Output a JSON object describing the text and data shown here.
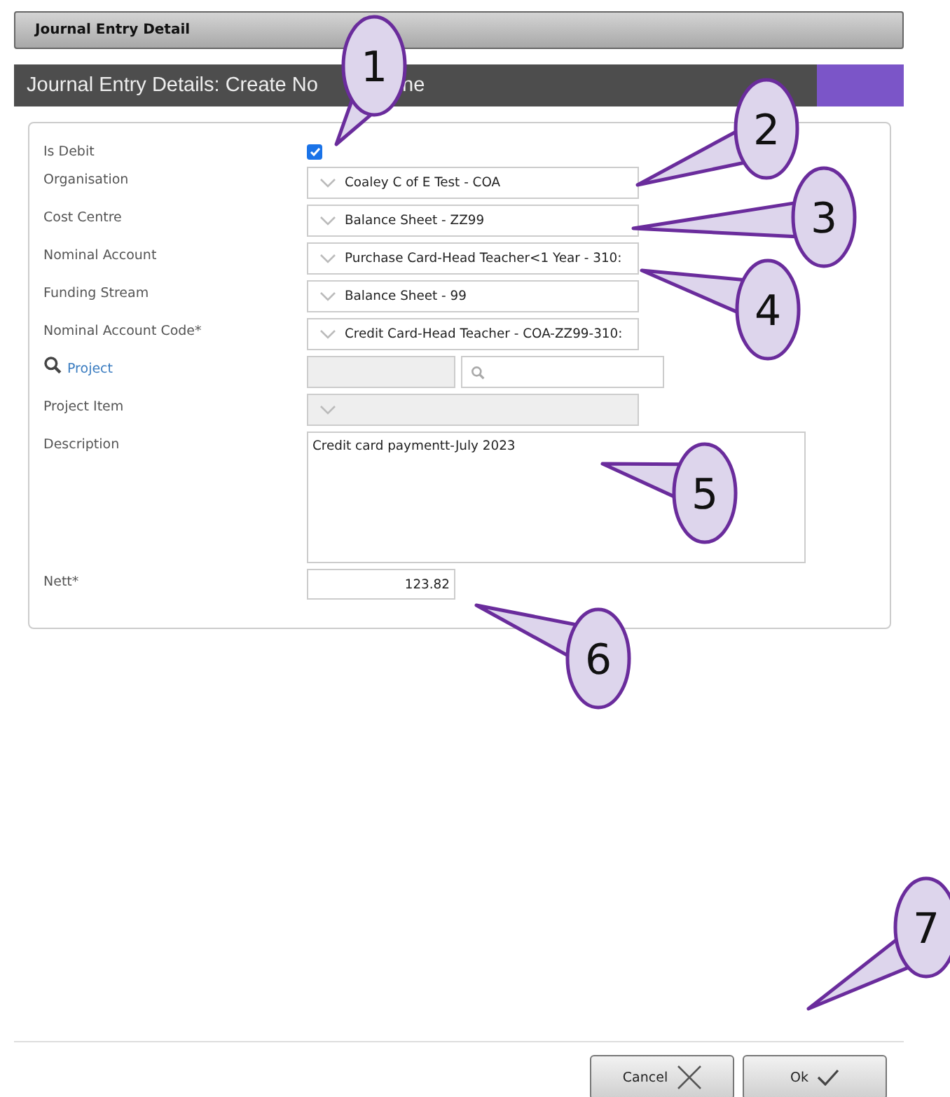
{
  "window": {
    "title": "Journal Entry Detail"
  },
  "header": {
    "title_start": "Journal Entry Details: Create No",
    "title_end": "ne"
  },
  "fields": [
    {
      "kind": "checkbox",
      "label": "Is Debit",
      "checked": true
    },
    {
      "kind": "select",
      "label": "Organisation",
      "value": "Coaley C of E  Test - COA"
    },
    {
      "kind": "select",
      "label": "Cost Centre",
      "value": "Balance Sheet - ZZ99"
    },
    {
      "kind": "select",
      "label": "Nominal Account",
      "value": "Purchase Card-Head Teacher<1 Year - 310:"
    },
    {
      "kind": "select",
      "label": "Funding Stream",
      "value": "Balance Sheet - 99"
    },
    {
      "kind": "select",
      "label": "Nominal Account Code*",
      "value": "Credit Card-Head Teacher - COA-ZZ99-310:"
    },
    {
      "kind": "lookup",
      "label": "Project"
    },
    {
      "kind": "select",
      "label": "Project Item",
      "disabled": true
    },
    {
      "kind": "textarea",
      "label": "Description",
      "value": "Credit card paymentt-July 2023"
    },
    {
      "kind": "number",
      "label": "Nett*",
      "value": "123.82"
    }
  ],
  "buttons": [
    {
      "kind": "cancel",
      "label": "Cancel"
    },
    {
      "kind": "ok",
      "label": "Ok"
    }
  ],
  "callouts": [
    "1",
    "2",
    "3",
    "4",
    "5",
    "6",
    "7"
  ]
}
